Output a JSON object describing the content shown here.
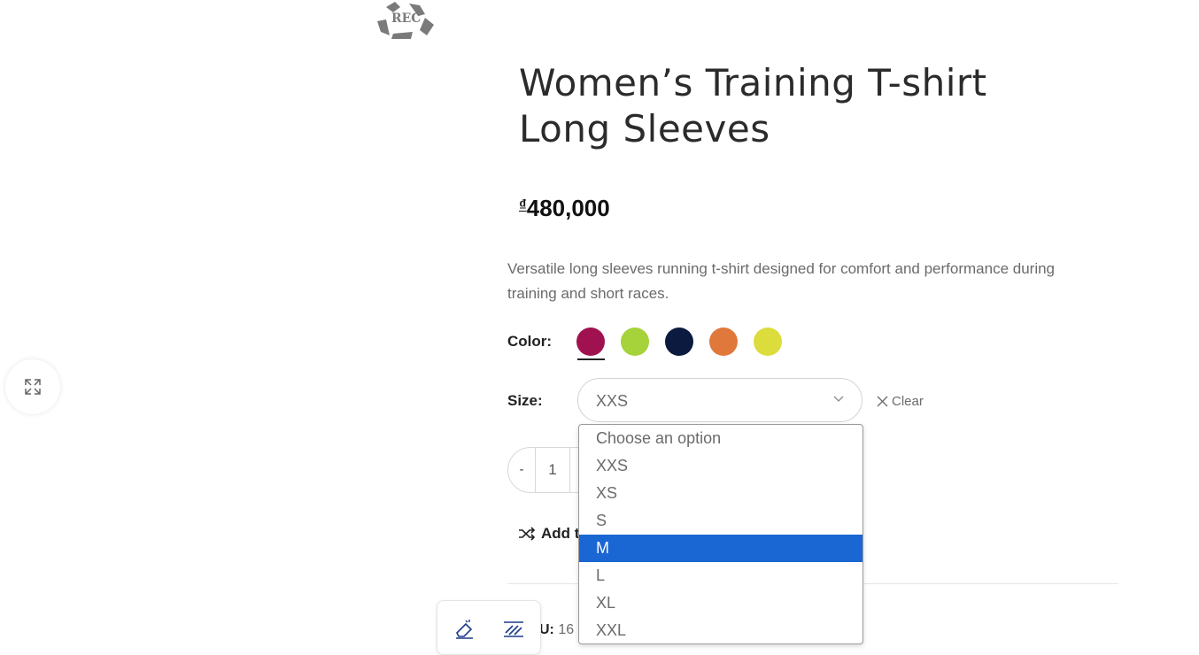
{
  "product": {
    "title_line1": "Women’s Training T-shirt",
    "title_line2": "Long Sleeves",
    "price_currency": "₫",
    "price_amount": "480,000",
    "description_line1": "Versatile long sleeves running t-shirt designed for comfort and performance during",
    "description_line2": "training and short races.",
    "logo_text": "REC"
  },
  "color": {
    "label": "Color:",
    "swatches": [
      {
        "name": "magenta",
        "hex": "#a0124f"
      },
      {
        "name": "lime",
        "hex": "#a6d23a"
      },
      {
        "name": "navy",
        "hex": "#0b1a3e"
      },
      {
        "name": "orange",
        "hex": "#e0783c"
      },
      {
        "name": "yellow",
        "hex": "#dcdc3c"
      }
    ],
    "selected_index": 0
  },
  "size": {
    "label": "Size:",
    "value": "XXS",
    "clear_label": "Clear",
    "options": [
      "Choose an option",
      "XXS",
      "XS",
      "S",
      "M",
      "L",
      "XL",
      "XXL"
    ],
    "highlighted": "M"
  },
  "quantity": {
    "minus": "-",
    "value": "1"
  },
  "compare": {
    "label": "Add t"
  },
  "sku": {
    "label": "U:",
    "value": "16"
  },
  "icons": {
    "expand": "expand-icon",
    "shuffle": "shuffle-icon",
    "chevron": "chevron-down-icon",
    "close": "close-icon",
    "eraser": "eraser-icon",
    "pattern": "pattern-icon"
  },
  "colors": {
    "highlight": "#1a66d2",
    "text_primary": "#2b2b2b",
    "text_muted": "#6b6b6b"
  }
}
